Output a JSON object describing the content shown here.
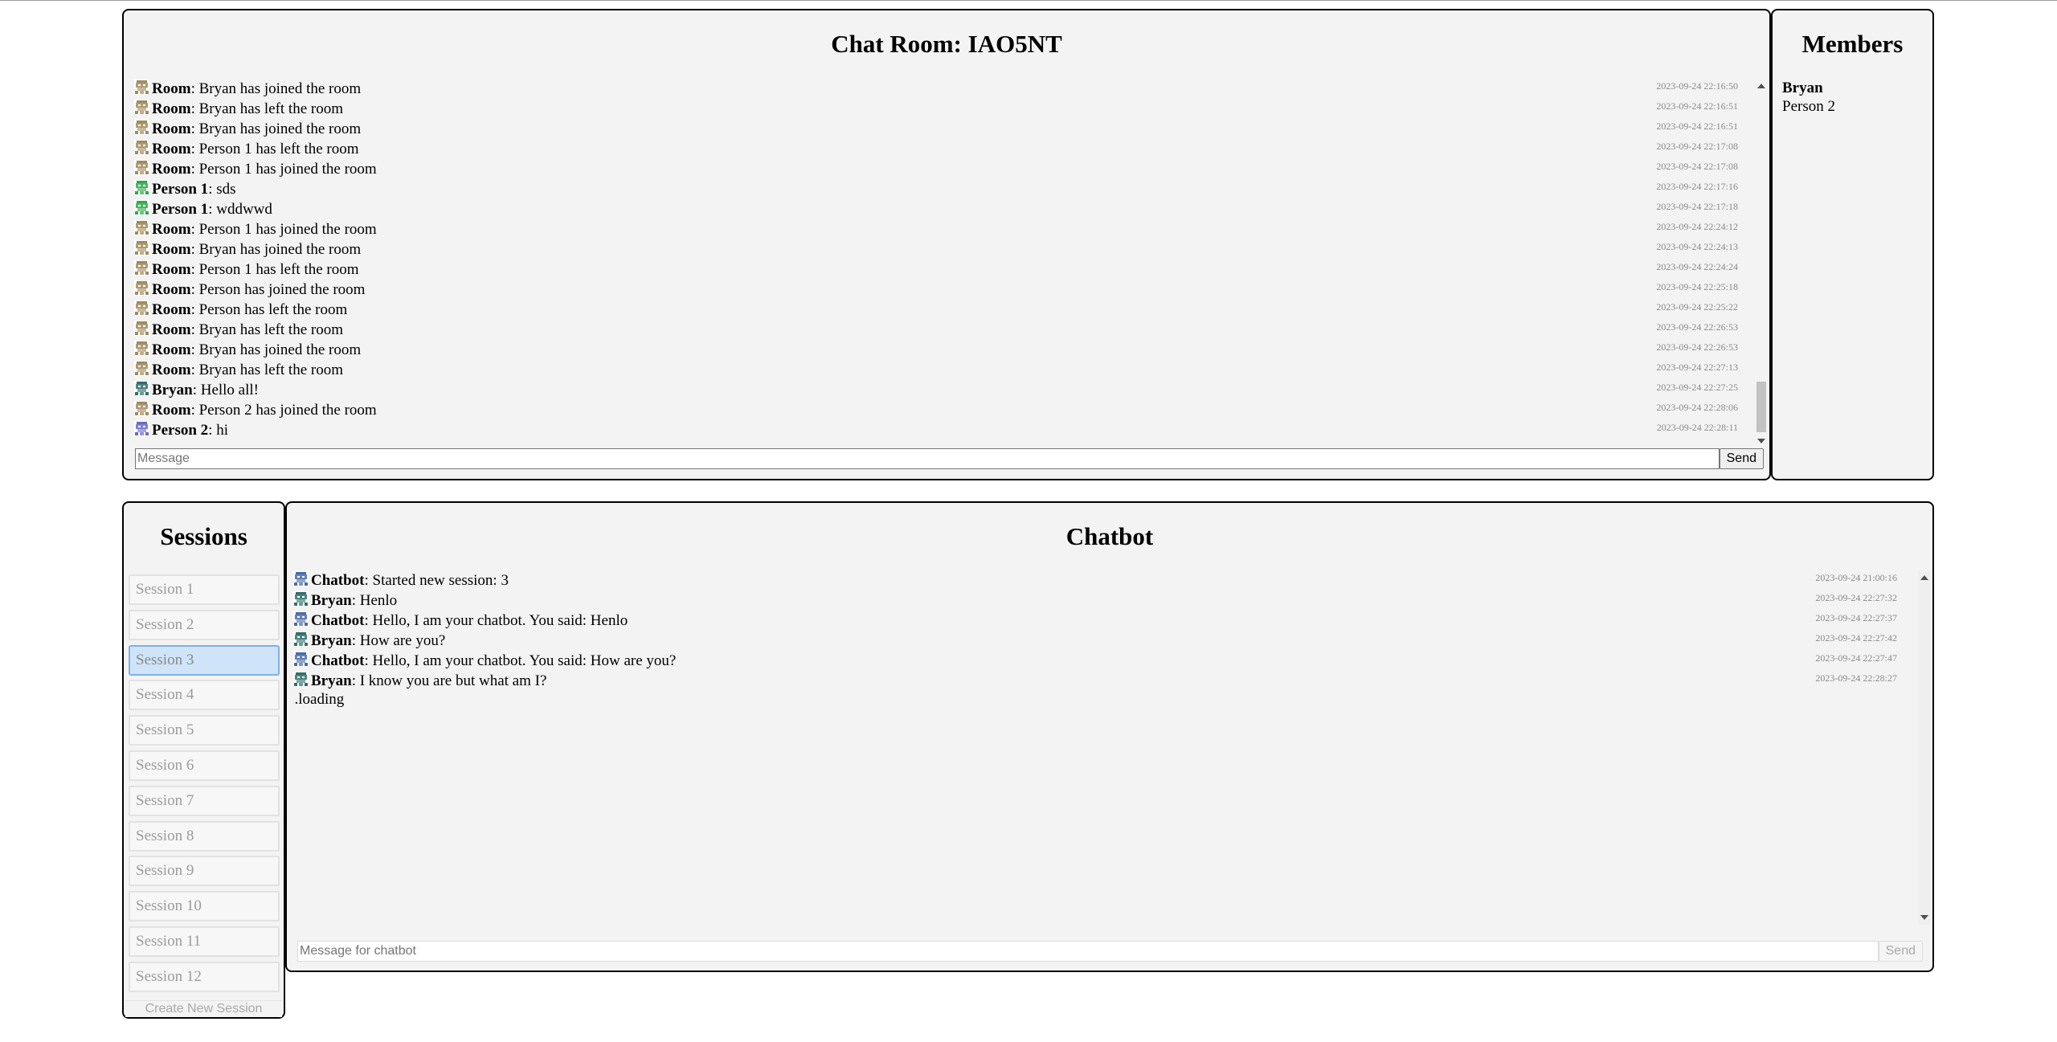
{
  "chat_room": {
    "title": "Chat Room: IAO5NT",
    "messages": [
      {
        "sender": "Room",
        "text": ": Bryan has joined the room",
        "time": "2023-09-24 22:16:50",
        "avatar": "room"
      },
      {
        "sender": "Room",
        "text": ": Bryan has left the room",
        "time": "2023-09-24 22:16:51",
        "avatar": "room"
      },
      {
        "sender": "Room",
        "text": ": Bryan has joined the room",
        "time": "2023-09-24 22:16:51",
        "avatar": "room"
      },
      {
        "sender": "Room",
        "text": ": Person 1 has left the room",
        "time": "2023-09-24 22:17:08",
        "avatar": "room"
      },
      {
        "sender": "Room",
        "text": ": Person 1 has joined the room",
        "time": "2023-09-24 22:17:08",
        "avatar": "room"
      },
      {
        "sender": "Person 1",
        "text": ": sds",
        "time": "2023-09-24 22:17:16",
        "avatar": "person1"
      },
      {
        "sender": "Person 1",
        "text": ": wddwwd",
        "time": "2023-09-24 22:17:18",
        "avatar": "person1"
      },
      {
        "sender": "Room",
        "text": ": Person 1 has joined the room",
        "time": "2023-09-24 22:24:12",
        "avatar": "room"
      },
      {
        "sender": "Room",
        "text": ": Bryan has joined the room",
        "time": "2023-09-24 22:24:13",
        "avatar": "room"
      },
      {
        "sender": "Room",
        "text": ": Person 1 has left the room",
        "time": "2023-09-24 22:24:24",
        "avatar": "room"
      },
      {
        "sender": "Room",
        "text": ": Person has joined the room",
        "time": "2023-09-24 22:25:18",
        "avatar": "room"
      },
      {
        "sender": "Room",
        "text": ": Person has left the room",
        "time": "2023-09-24 22:25:22",
        "avatar": "room"
      },
      {
        "sender": "Room",
        "text": ": Bryan has left the room",
        "time": "2023-09-24 22:26:53",
        "avatar": "room"
      },
      {
        "sender": "Room",
        "text": ": Bryan has joined the room",
        "time": "2023-09-24 22:26:53",
        "avatar": "room"
      },
      {
        "sender": "Room",
        "text": ": Bryan has left the room",
        "time": "2023-09-24 22:27:13",
        "avatar": "room"
      },
      {
        "sender": "Bryan",
        "text": ": Hello all!",
        "time": "2023-09-24 22:27:25",
        "avatar": "bryan"
      },
      {
        "sender": "Room",
        "text": ": Person 2 has joined the room",
        "time": "2023-09-24 22:28:06",
        "avatar": "room"
      },
      {
        "sender": "Person 2",
        "text": ": hi",
        "time": "2023-09-24 22:28:11",
        "avatar": "person2"
      }
    ],
    "input_placeholder": "Message",
    "send_label": "Send"
  },
  "members": {
    "title": "Members",
    "list": [
      {
        "name": "Bryan",
        "bold": true
      },
      {
        "name": "Person 2",
        "bold": false
      }
    ]
  },
  "sessions": {
    "title": "Sessions",
    "items": [
      "Session 1",
      "Session 2",
      "Session 3",
      "Session 4",
      "Session 5",
      "Session 6",
      "Session 7",
      "Session 8",
      "Session 9",
      "Session 10",
      "Session 11",
      "Session 12"
    ],
    "active_index": 2,
    "create_label": "Create New Session"
  },
  "chatbot": {
    "title": "Chatbot",
    "messages": [
      {
        "sender": "Chatbot",
        "text": ": Started new session: 3",
        "time": "2023-09-24 21:00:16",
        "avatar": "chatbot"
      },
      {
        "sender": "Bryan",
        "text": ": Henlo",
        "time": "2023-09-24 22:27:32",
        "avatar": "bryan"
      },
      {
        "sender": "Chatbot",
        "text": ": Hello, I am your chatbot. You said: Henlo",
        "time": "2023-09-24 22:27:37",
        "avatar": "chatbot"
      },
      {
        "sender": "Bryan",
        "text": ": How are you?",
        "time": "2023-09-24 22:27:42",
        "avatar": "bryan"
      },
      {
        "sender": "Chatbot",
        "text": ": Hello, I am your chatbot. You said: How are you?",
        "time": "2023-09-24 22:27:47",
        "avatar": "chatbot"
      },
      {
        "sender": "Bryan",
        "text": ": I know you are but what am I?",
        "time": "2023-09-24 22:28:27",
        "avatar": "bryan"
      }
    ],
    "loading_text": "...loading",
    "input_placeholder": "Message for chatbot",
    "send_label": "Send"
  },
  "avatar_colors": {
    "room": "#a08a5c",
    "person1": "#2fa84a",
    "bryan": "#2f6e6a",
    "person2": "#6a6ac8",
    "chatbot": "#4a6aa8"
  }
}
